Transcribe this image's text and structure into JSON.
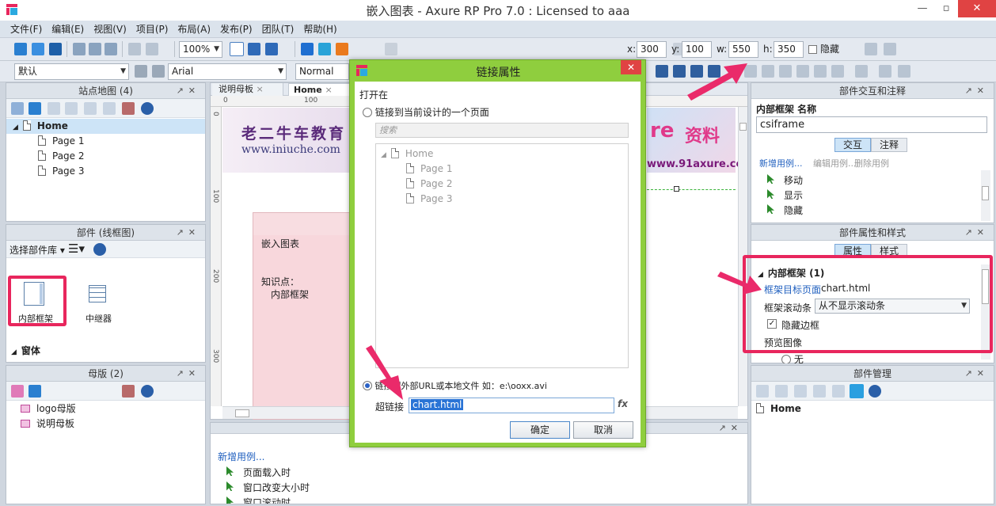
{
  "window": {
    "title": "嵌入图表 - Axure RP Pro 7.0 : Licensed to aaa",
    "minimize": "—",
    "restore": "▫",
    "close": "✕"
  },
  "menu": [
    "文件(F)",
    "编辑(E)",
    "视图(V)",
    "项目(P)",
    "布局(A)",
    "发布(P)",
    "团队(T)",
    "帮助(H)"
  ],
  "toolbar": {
    "zoom": "100%",
    "font_style": "默认",
    "font_family": "Arial",
    "font_weight": "Normal",
    "x_label": "x:",
    "x_value": "300",
    "y_label": "y:",
    "y_value": "100",
    "w_label": "w:",
    "w_value": "550",
    "h_label": "h:",
    "h_value": "350",
    "hidden_label": "隐藏"
  },
  "sitemap": {
    "title": "站点地图 (4)",
    "pages": [
      "Home",
      "Page 1",
      "Page 2",
      "Page 3"
    ]
  },
  "widgets": {
    "title": "部件 (线框图)",
    "library_label": "选择部件库",
    "items": [
      "内部框架",
      "中继器"
    ],
    "section": "窗体"
  },
  "masters": {
    "title": "母版 (2)",
    "items": [
      "logo母版",
      "说明母板"
    ]
  },
  "canvas": {
    "tabs": [
      "说明母板",
      "Home"
    ],
    "ruler_top": [
      "0",
      "100"
    ],
    "ruler_left": [
      "0",
      "100",
      "200",
      "300"
    ],
    "banner_left_cn": "老二牛车教育",
    "banner_left_url": "www.iniuche.com",
    "banner_right_brand": "re",
    "banner_right_cn": "资料",
    "banner_right_url": "www.91axure.co",
    "note_title": "嵌入图表",
    "note_label": "知识点：",
    "note_value": "内部框架"
  },
  "events": {
    "add_case": "新增用例...",
    "items": [
      "页面载入时",
      "窗口改变大小时",
      "窗口滚动时"
    ]
  },
  "dialog": {
    "title": "链接属性",
    "open_in": "打开在",
    "option_page": "链接到当前设计的一个页面",
    "search_placeholder": "搜索",
    "tree": [
      "Home",
      "Page 1",
      "Page 2",
      "Page 3"
    ],
    "option_url": "链接到外部URL或本地文件 如：e:\\ooxx.avi",
    "hyperlink_label": "超链接",
    "hyperlink_value": "chart.html",
    "fx": "fx",
    "ok": "确定",
    "cancel": "取消"
  },
  "interaction": {
    "title": "部件交互和注释",
    "name_label": "内部框架  名称",
    "name_value": "csiframe",
    "tab_interact": "交互",
    "tab_notes": "注释",
    "add_case": "新增用例...",
    "edit_case": "编辑用例...",
    "delete_case": "删除用例",
    "actions": [
      "移动",
      "显示",
      "隐藏"
    ]
  },
  "properties": {
    "title": "部件属性和样式",
    "tab_props": "属性",
    "tab_style": "样式",
    "section": "内部框架 (1)",
    "target_label": "框架目标页面",
    "target_value": "chart.html",
    "scroll_label": "框架滚动条",
    "scroll_value": "从不显示滚动条",
    "hide_border": "隐藏边框",
    "preview": "预览图像",
    "none": "无"
  },
  "manager": {
    "title": "部件管理",
    "root": "Home"
  },
  "colors": {
    "accent_green": "#8fce3e",
    "highlight_red": "#e8265d",
    "link_blue": "#1f5fbf"
  }
}
